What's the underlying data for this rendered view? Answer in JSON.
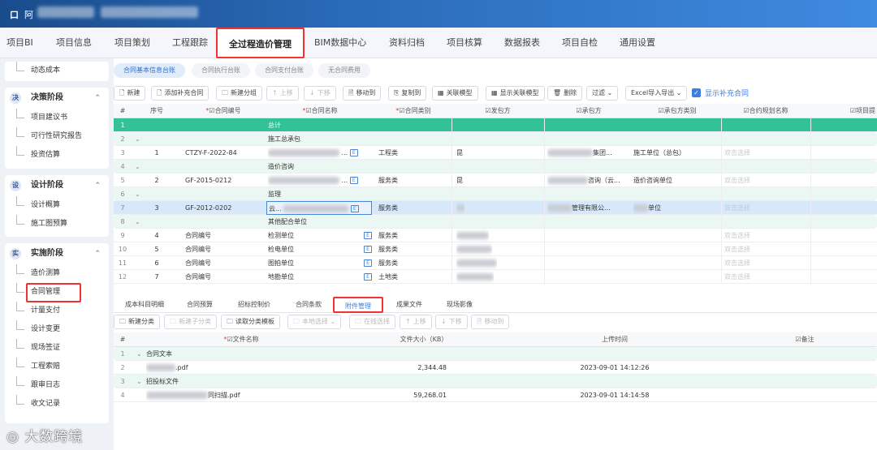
{
  "window": {
    "app_icon": "口",
    "title": "阿"
  },
  "topnav": [
    "项目BI",
    "项目信息",
    "项目策划",
    "工程跟踪",
    "全过程造价管理",
    "BIM数据中心",
    "资料归档",
    "项目核算",
    "数据报表",
    "项目自检",
    "通用设置"
  ],
  "sidebar": {
    "top_item": "动态成本",
    "groups": [
      {
        "icon": "决",
        "label": "决策阶段",
        "items": [
          "项目建议书",
          "可行性研究报告",
          "投资估算"
        ]
      },
      {
        "icon": "设",
        "label": "设计阶段",
        "items": [
          "设计概算",
          "施工图预算"
        ]
      },
      {
        "icon": "实",
        "label": "实施阶段",
        "items": [
          "造价测算",
          "合同管理",
          "计量支付",
          "设计变更",
          "现场签证",
          "工程索赔",
          "跟审日志",
          "收文记录"
        ]
      }
    ]
  },
  "subtabs": [
    "合同基本信息台账",
    "合同执行台账",
    "合同支付台账",
    "无合同费用"
  ],
  "toolbar": {
    "buttons": [
      "新建",
      "添加补充合同",
      "新建分组",
      "上移",
      "下移",
      "移动到",
      "复制到",
      "关联模型",
      "显示关联模型",
      "删除",
      "过滤",
      "Excel导入导出"
    ],
    "checkbox_label": "显示补充合同"
  },
  "grid": {
    "headers": [
      "#",
      "序号",
      "合同编号",
      "合同名称",
      "合同类别",
      "发包方",
      "承包方",
      "承包方类别",
      "合约规划名称",
      "项目提"
    ],
    "rows": [
      {
        "n": "1",
        "type": "total",
        "name": "总计"
      },
      {
        "n": "2",
        "type": "group",
        "name": "施工总承包"
      },
      {
        "n": "3",
        "type": "data",
        "seq": "1",
        "code": "CTZY-F-2022-84",
        "name_tail": "...",
        "category": "工程类",
        "party_a": "昆",
        "party_b": "集团...",
        "b_type": "施工单位（总包）",
        "plan": "双击选择"
      },
      {
        "n": "4",
        "type": "group",
        "name": "造价咨询"
      },
      {
        "n": "5",
        "type": "data",
        "seq": "2",
        "code": "GF-2015-0212",
        "name_tail": "...",
        "category": "服务类",
        "party_a": "昆",
        "party_b": "咨询（云...",
        "b_type": "造价咨询单位",
        "plan": "双击选择"
      },
      {
        "n": "6",
        "type": "group",
        "name": "监理"
      },
      {
        "n": "7",
        "type": "sel",
        "seq": "3",
        "code": "GF-2012-0202",
        "name_tail": "云...",
        "category": "服务类",
        "party_a": "",
        "party_b": "管理有限公...",
        "b_type": "单位",
        "plan": "双击选择"
      },
      {
        "n": "8",
        "type": "group",
        "name": "其他配合单位"
      },
      {
        "n": "9",
        "type": "data",
        "seq": "4",
        "code": "合同编号",
        "name": "检测单位",
        "category": "服务类",
        "plan": "双击选择"
      },
      {
        "n": "10",
        "type": "data",
        "seq": "5",
        "code": "合同编号",
        "name": "检电单位",
        "category": "服务类",
        "plan": "双击选择"
      },
      {
        "n": "11",
        "type": "data",
        "seq": "6",
        "code": "合同编号",
        "name": "图拍单位",
        "category": "服务类",
        "plan": "双击选择"
      },
      {
        "n": "12",
        "type": "data",
        "seq": "7",
        "code": "合同编号",
        "name": "地勘单位",
        "category": "土地类",
        "plan": "双击选择"
      }
    ]
  },
  "bottom_tabs": [
    "成本科目明细",
    "合同预算",
    "招标控制价",
    "合同条款",
    "附件管理",
    "成果文件",
    "现场影像"
  ],
  "bottom_toolbar": [
    "新建分类",
    "新建子分类",
    "读取分类模板",
    "本地选择",
    "在线选择",
    "上移",
    "下移",
    "移动到"
  ],
  "attachments": {
    "headers": [
      "#",
      "文件名称",
      "文件大小（KB）",
      "上传时间",
      "备注"
    ],
    "rows": [
      {
        "n": "1",
        "type": "group",
        "name": "合同文本"
      },
      {
        "n": "2",
        "type": "file",
        "name": ".pdf",
        "size": "2,344.48",
        "time": "2023-09-01 14:12:26"
      },
      {
        "n": "3",
        "type": "group",
        "name": "招投标文件"
      },
      {
        "n": "4",
        "type": "file",
        "name": "同扫描.pdf",
        "size": "59,268.01",
        "time": "2023-09-01 14:14:58"
      }
    ]
  },
  "watermark": "大数跨境",
  "colors": {
    "accent": "#3d7fe0",
    "total_row": "#33c19a",
    "highlight_box": "#e33333"
  }
}
